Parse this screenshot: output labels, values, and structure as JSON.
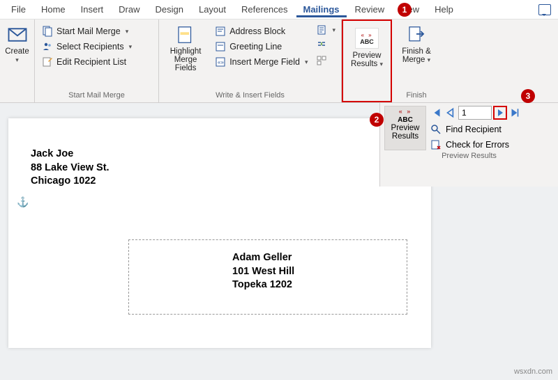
{
  "tabs": [
    "File",
    "Home",
    "Insert",
    "Draw",
    "Design",
    "Layout",
    "References",
    "Mailings",
    "Review",
    "View",
    "Help"
  ],
  "active_tab": "Mailings",
  "groups": {
    "create": {
      "label": "Create",
      "create_btn": "Create"
    },
    "start_mm": {
      "label": "Start Mail Merge",
      "start": "Start Mail Merge",
      "select": "Select Recipients",
      "edit": "Edit Recipient List"
    },
    "write": {
      "label": "Write & Insert Fields",
      "highlight_l1": "Highlight",
      "highlight_l2": "Merge Fields",
      "address": "Address Block",
      "greeting": "Greeting Line",
      "insert": "Insert Merge Field"
    },
    "preview": {
      "l1": "Preview",
      "l2": "Results"
    },
    "finish": {
      "label": "Finish",
      "l1": "Finish &",
      "l2": "Merge"
    }
  },
  "preview_panel": {
    "abc": "ABC",
    "btn_l1": "Preview",
    "btn_l2": "Results",
    "record_value": "1",
    "find": "Find Recipient",
    "check": "Check for Errors",
    "label": "Preview Results"
  },
  "callouts": {
    "c1": "1",
    "c2": "2",
    "c3": "3"
  },
  "document": {
    "return_address": {
      "name": "Jack Joe",
      "street": "88 Lake View St.",
      "city": "Chicago 1022"
    },
    "delivery_address": {
      "name": "Adam Geller",
      "street": "101 West Hill",
      "city": "Topeka 1202"
    }
  },
  "watermark": "wsxdn.com"
}
